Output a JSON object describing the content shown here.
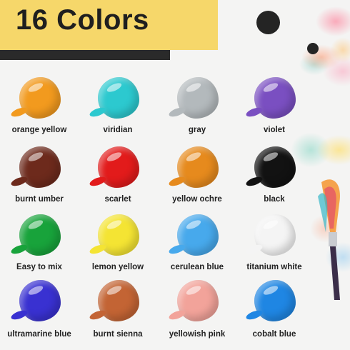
{
  "header": {
    "title": "16 Colors"
  },
  "swatches": [
    {
      "label": "orange yellow",
      "color": "#f29a1e"
    },
    {
      "label": "viridian",
      "color": "#2cc9cf"
    },
    {
      "label": "gray",
      "color": "#b3b9bc"
    },
    {
      "label": "violet",
      "color": "#7a4fc1"
    },
    {
      "label": "burnt umber",
      "color": "#6d2a1c"
    },
    {
      "label": "scarlet",
      "color": "#e21b1b"
    },
    {
      "label": "yellow ochre",
      "color": "#e68a1d"
    },
    {
      "label": "black",
      "color": "#121212"
    },
    {
      "label": "Easy to mix",
      "color": "#18a33b"
    },
    {
      "label": "lemon yellow",
      "color": "#f4e433"
    },
    {
      "label": "cerulean blue",
      "color": "#47a9ec"
    },
    {
      "label": "titanium white",
      "color": "#f4f4f4"
    },
    {
      "label": "ultramarine blue",
      "color": "#3931d1"
    },
    {
      "label": "burnt sienna",
      "color": "#c36434"
    },
    {
      "label": "yellowish pink",
      "color": "#f2a39a"
    },
    {
      "label": "cobalt blue",
      "color": "#1f86e3"
    }
  ]
}
